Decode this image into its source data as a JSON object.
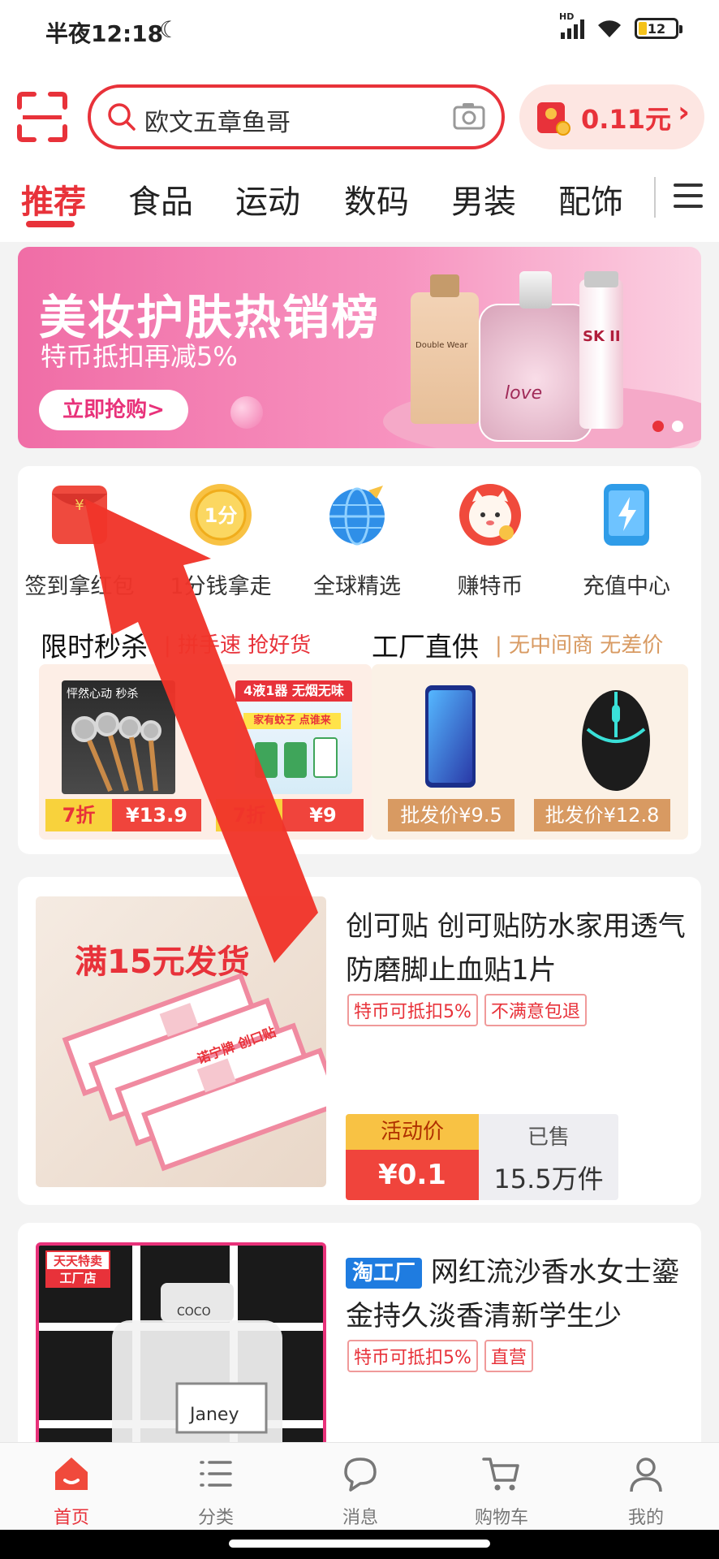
{
  "status_bar": {
    "time": "半夜12:18",
    "network": "HD",
    "battery": "12"
  },
  "header": {
    "search_text": "欧文五章鱼哥",
    "coupon_amount": "0.11元"
  },
  "tabs": [
    {
      "label": "推荐",
      "active": true
    },
    {
      "label": "食品"
    },
    {
      "label": "运动"
    },
    {
      "label": "数码"
    },
    {
      "label": "男装"
    },
    {
      "label": "配饰"
    }
  ],
  "banner": {
    "title": "美妆护肤热销榜",
    "subtitle": "特币抵扣再减5%",
    "cta": "立即抢购>",
    "brand_text_1": "Double Wear",
    "brand_text_2": "love",
    "brand_text_3": "SK II",
    "slides": 2,
    "active_slide": 1
  },
  "quick_menu": [
    {
      "label": "签到拿红包",
      "icon": "red-envelope-icon"
    },
    {
      "label": "1分钱拿走",
      "icon": "one-cent-coin-icon",
      "badge": "1分"
    },
    {
      "label": "全球精选",
      "icon": "globe-plane-icon"
    },
    {
      "label": "赚特币",
      "icon": "lucky-cat-icon"
    },
    {
      "label": "充值中心",
      "icon": "phone-charge-icon"
    }
  ],
  "flash_sale": {
    "title": "限时秒杀",
    "subtitle": "| 拼手速 抢好货",
    "items": [
      {
        "discount": "7折",
        "price": "¥13.9",
        "image_text": "怦然心动 秒杀"
      },
      {
        "discount": "7折",
        "price": "¥9",
        "image_text": "4液1器 无烟无味",
        "image_text_2": "家有蚊子 点谁来"
      }
    ]
  },
  "factory_direct": {
    "title": "工厂直供",
    "subtitle": "| 无中间商 无差价",
    "items": [
      {
        "price": "批发价¥9.5",
        "image": "smartphone"
      },
      {
        "price": "批发价¥12.8",
        "image": "gaming-mouse"
      }
    ]
  },
  "products": [
    {
      "title": "创可贴 创可贴防水家用透气防磨脚止血贴1片",
      "tags": [
        "特币可抵扣5%",
        "不满意包退"
      ],
      "deal_label": "活动价",
      "deal_price": "¥0.1",
      "sold_label": "已售",
      "sold_count": "15.5万件",
      "image_text": "满15元发货",
      "image_brand": "诺宁牌 创口贴"
    },
    {
      "badge": "淘工厂",
      "title": "网红流沙香水女士鎏金持久淡香清新学生少",
      "tags": [
        "特币可抵扣5%",
        "直营"
      ],
      "image_stamp_1": "天天特卖",
      "image_stamp_2": "工厂店",
      "image_text": "Janey",
      "image_cap_text": "COCO"
    }
  ],
  "bottom_nav": [
    {
      "label": "首页",
      "active": true
    },
    {
      "label": "分类"
    },
    {
      "label": "消息"
    },
    {
      "label": "购物车"
    },
    {
      "label": "我的"
    }
  ],
  "colors": {
    "accent": "#e8323a",
    "banner_pink": "#f06da6",
    "deal_yellow": "#f8c244",
    "factory_tan": "#d89a62"
  }
}
